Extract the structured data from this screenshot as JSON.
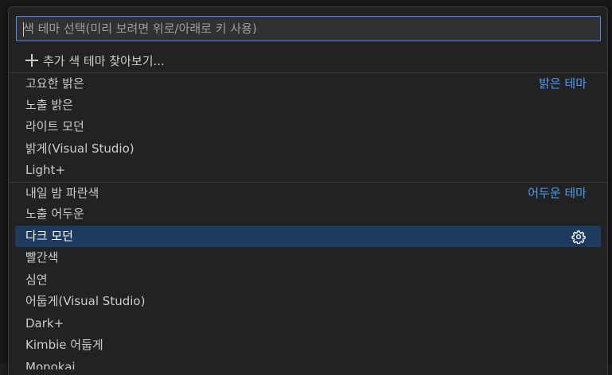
{
  "quick_pick": {
    "placeholder": "색 테마 선택(미리 보려면 위로/아래로 키 사용)",
    "action_item": {
      "label": "추가 색 테마 찾아보기...",
      "icon": "plus-icon"
    },
    "light_group_label": "밝은 테마",
    "dark_group_label": "어두운 테마",
    "light_themes": [
      {
        "label": "고요한 밝은"
      },
      {
        "label": "노출 밝은"
      },
      {
        "label": "라이트 모던"
      },
      {
        "label": "밝게(Visual Studio)"
      },
      {
        "label": "Light+"
      }
    ],
    "dark_themes": [
      {
        "label": "내일 밤 파란색"
      },
      {
        "label": "노출 어두운"
      },
      {
        "label": "다크 모던",
        "selected": true,
        "icon": "gear-icon"
      },
      {
        "label": "빨간색"
      },
      {
        "label": "심연"
      },
      {
        "label": "어둡게(Visual Studio)"
      },
      {
        "label": "Dark+"
      },
      {
        "label": "Kimbie 어둡게"
      },
      {
        "label": "Monokai"
      }
    ]
  },
  "colors": {
    "accent": "#4c8de8",
    "group_label": "#4c9bf5",
    "selection": "#1f3a5f",
    "background": "#222222"
  }
}
